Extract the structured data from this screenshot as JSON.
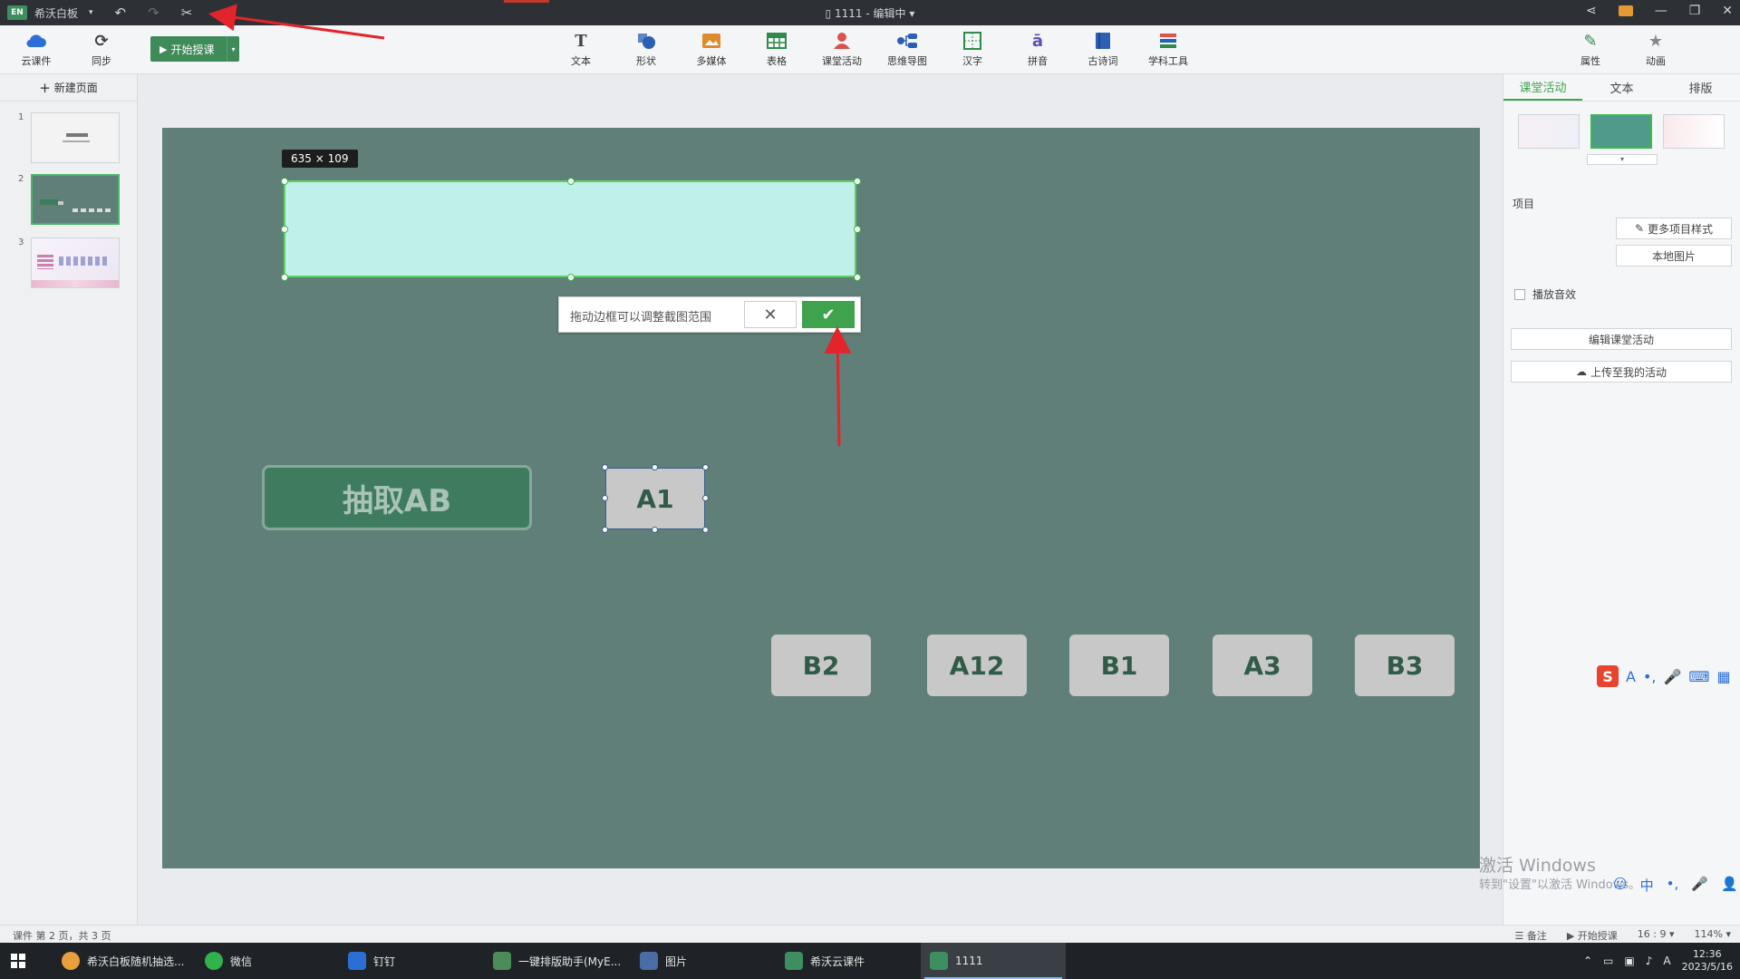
{
  "titlebar": {
    "app_logo": "EN",
    "app_name": "希沃白板",
    "doc_title": "1111 - 编辑中",
    "icons": [
      "undo-icon",
      "redo-icon",
      "scissors-icon",
      "share-icon",
      "mail-icon",
      "minimize-icon",
      "restore-icon",
      "close-icon"
    ]
  },
  "toolbar": {
    "cloud": "云课件",
    "sync": "同步",
    "start_teaching": "开始授课",
    "items": [
      {
        "label": "文本",
        "icon": "text-icon",
        "color": "#444444"
      },
      {
        "label": "形状",
        "icon": "shape-icon",
        "color": "#2b5fb3"
      },
      {
        "label": "多媒体",
        "icon": "media-icon",
        "color": "#e08a2c"
      },
      {
        "label": "表格",
        "icon": "table-icon",
        "color": "#2f8a4c"
      },
      {
        "label": "课堂活动",
        "icon": "activity-icon",
        "color": "#d9534f"
      },
      {
        "label": "思维导图",
        "icon": "mindmap-icon",
        "color": "#2b5fb3"
      },
      {
        "label": "汉字",
        "icon": "hanzi-icon",
        "color": "#2f8a4c"
      },
      {
        "label": "拼音",
        "icon": "pinyin-icon",
        "color": "#5a4fb3"
      },
      {
        "label": "古诗词",
        "icon": "poem-icon",
        "color": "#2b5fb3"
      },
      {
        "label": "学科工具",
        "icon": "tools-icon",
        "color": "#d9534f"
      }
    ],
    "properties": "属性",
    "animation": "动画"
  },
  "left_panel": {
    "new_page": "新建页面",
    "pages": [
      "1",
      "2",
      "3"
    ],
    "active_page": 2
  },
  "canvas": {
    "selection_size": "635 × 109",
    "crop_hint": "拖动边框可以调整截图范围",
    "draw_button": "抽取AB",
    "selected_card": "A1",
    "cards": [
      "B2",
      "A12",
      "B1",
      "A3",
      "B3"
    ],
    "slide_color": "#5f7f78",
    "crop_fill": "#bff0ea",
    "confirm_color": "#3fa34d"
  },
  "right_panel": {
    "tabs": [
      "课堂活动",
      "文本",
      "排版"
    ],
    "active_tab": "课堂活动",
    "section_label": "项目",
    "more_styles": "更多项目样式",
    "local_image": "本地图片",
    "play_sound": "播放音效",
    "edit_activity": "编辑课堂活动",
    "upload_activity": "上传至我的活动"
  },
  "watermark": {
    "line1": "激活 Windows",
    "line2": "转到\"设置\"以激活 Windows。"
  },
  "statusbar": {
    "page_info": "课件 第 2 页，共 3 页",
    "notes": "备注",
    "start": "开始授课",
    "ratio": "16 : 9",
    "zoom": "114%"
  },
  "taskbar": {
    "tasks": [
      {
        "label": "希沃白板随机抽选...",
        "icon_color": "#e8a13a"
      },
      {
        "label": "微信",
        "icon_color": "#2fb34a"
      },
      {
        "label": "钉钉",
        "icon_color": "#2b6fd6"
      },
      {
        "label": "一键排版助手(MyE...",
        "icon_color": "#4b8b5a"
      },
      {
        "label": "图片",
        "icon_color": "#4a6da8"
      },
      {
        "label": "希沃云课件",
        "icon_color": "#3d8f5f"
      },
      {
        "label": "1111",
        "icon_color": "#3d8f5f"
      }
    ],
    "time": "12:36",
    "date": "2023/5/16",
    "tray_ime": "A"
  }
}
